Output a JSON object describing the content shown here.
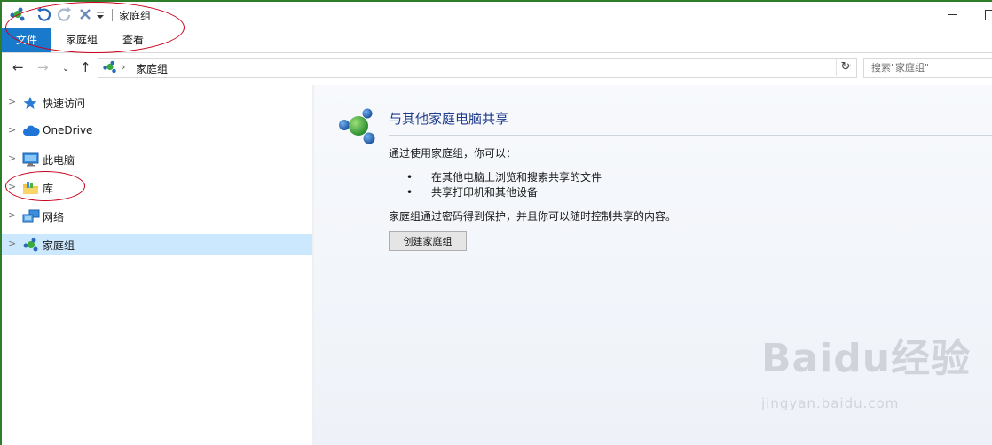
{
  "window": {
    "title": "家庭组",
    "minimize_label": "",
    "maximize_label": ""
  },
  "ribbon": {
    "tabs": [
      {
        "label": "文件",
        "active": true
      },
      {
        "label": "家庭组",
        "active": false
      },
      {
        "label": "查看",
        "active": false
      }
    ]
  },
  "address_bar": {
    "path": "家庭组",
    "separator": "›",
    "search_placeholder": "搜索\"家庭组\""
  },
  "nav_pane": {
    "items": [
      {
        "label": "快速访问",
        "icon": "star-icon"
      },
      {
        "label": "OneDrive",
        "icon": "cloud-icon"
      },
      {
        "label": "此电脑",
        "icon": "computer-icon"
      },
      {
        "label": "库",
        "icon": "library-folder-icon"
      },
      {
        "label": "网络",
        "icon": "network-icon"
      },
      {
        "label": "家庭组",
        "icon": "homegroup-icon",
        "selected": true
      }
    ]
  },
  "content": {
    "title": "与其他家庭电脑共享",
    "intro": "通过使用家庭组，你可以：",
    "bullets": [
      "在其他电脑上浏览和搜索共享的文件",
      "共享打印机和其他设备"
    ],
    "description": "家庭组通过密码得到保护，并且你可以随时控制共享的内容。",
    "button_label": "创建家庭组"
  },
  "watermark": {
    "logo": "Baidu经验",
    "url": "jingyan.baidu.com"
  },
  "colors": {
    "accent": "#1979ca",
    "selection": "#cce8ff",
    "title_blue": "#1e3a8a",
    "annotation_red": "#c8001a",
    "desktop_green": "#2e7d2a"
  }
}
